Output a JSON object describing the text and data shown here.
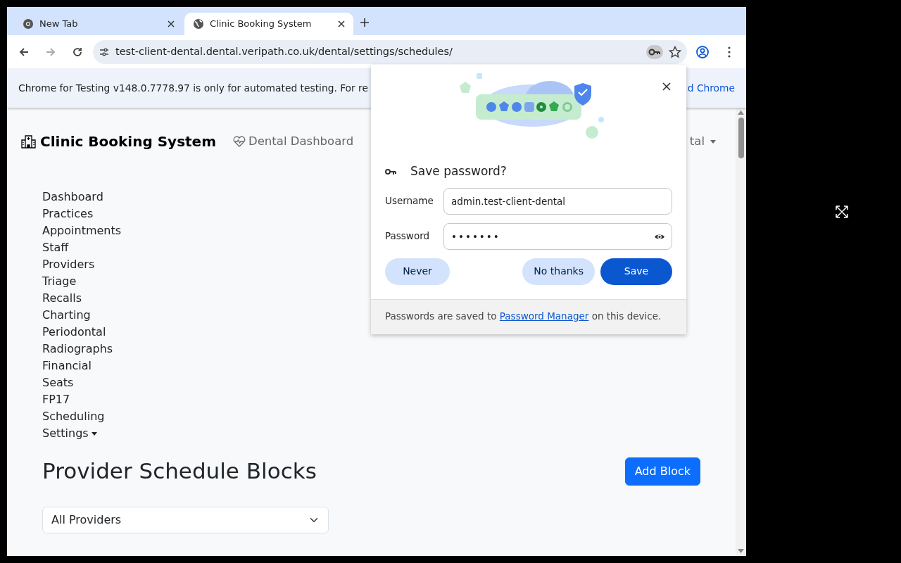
{
  "browser": {
    "tabs": [
      {
        "title": "New Tab",
        "selected": false
      },
      {
        "title": "Clinic Booking System",
        "selected": true
      }
    ],
    "url": "test-client-dental.dental.veripath.co.uk/dental/settings/schedules/"
  },
  "info_bar": {
    "text": "Chrome for Testing v148.0.7778.97 is only for automated testing. For re",
    "link": "d Chrome"
  },
  "page": {
    "brand": "Clinic Booking System",
    "nav_link": "Dental Dashboard",
    "user_menu": "tal",
    "sidebar": [
      {
        "label": "Dashboard",
        "kind": "link"
      },
      {
        "label": "Practices",
        "kind": "link"
      },
      {
        "label": "Appointments",
        "kind": "link"
      },
      {
        "label": "Staff",
        "kind": "link"
      },
      {
        "label": "Providers",
        "kind": "link"
      },
      {
        "label": "Triage",
        "kind": "link"
      },
      {
        "label": "Recalls",
        "kind": "link"
      },
      {
        "label": "Charting",
        "kind": "link"
      },
      {
        "label": "Periodontal",
        "kind": "link"
      },
      {
        "label": "Radiographs",
        "kind": "link"
      },
      {
        "label": "Financial",
        "kind": "link"
      },
      {
        "label": "Seats",
        "kind": "link"
      },
      {
        "label": "FP17",
        "kind": "link"
      },
      {
        "label": "Scheduling",
        "kind": "link"
      },
      {
        "label": "Settings",
        "kind": "dropdown"
      }
    ],
    "heading": "Provider Schedule Blocks",
    "add_button": "Add Block",
    "provider_select": "All Providers"
  },
  "password_dialog": {
    "title": "Save password?",
    "username_label": "Username",
    "username": "admin.test-client-dental",
    "password_label": "Password",
    "password": "•••••••",
    "buttons": [
      {
        "label": "Never",
        "kind": "tonal"
      },
      {
        "label": "No thanks",
        "kind": "tonal"
      },
      {
        "label": "Save",
        "kind": "primary"
      }
    ],
    "footer": "Passwords are saved to ",
    "footer_link": "Password Manager",
    "footer_end": " on this device."
  }
}
